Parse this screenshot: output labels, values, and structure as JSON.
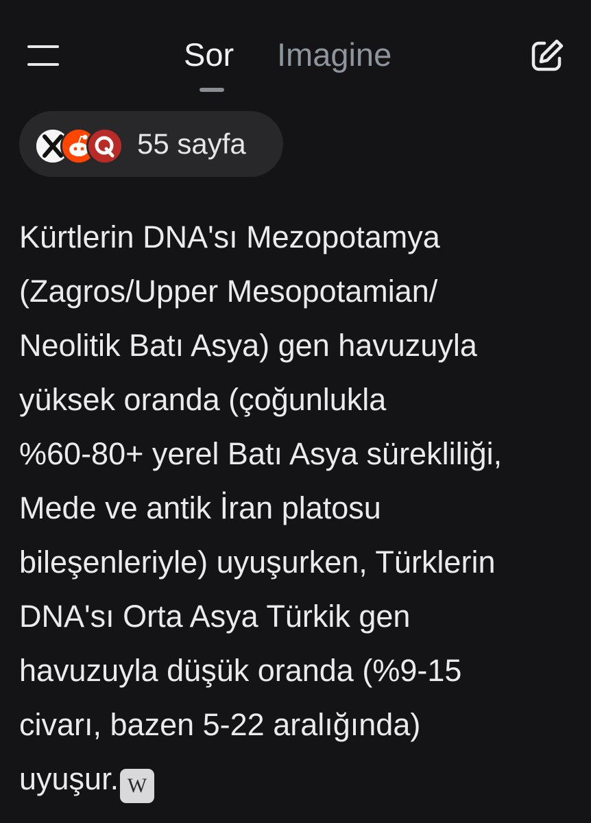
{
  "header": {
    "tabs": [
      {
        "label": "Sor",
        "active": true
      },
      {
        "label": "Imagine",
        "active": false
      }
    ],
    "menu_icon": "hamburger-menu-icon",
    "new_chat_icon": "edit-square-icon"
  },
  "sources": {
    "label": "55 sayfa",
    "favicons": [
      "x-icon",
      "reddit-icon",
      "quora-icon"
    ]
  },
  "answer": {
    "lines": [
      "Kürtlerin DNA'sı Mezopotamya",
      "(Zagros/Upper Mesopotamian/",
      "Neolitik Batı Asya) gen havuzuyla",
      "yüksek oranda (çoğunlukla",
      "%60-80+ yerel Batı Asya sürekliliği,",
      "Mede ve antik İran platosu",
      "bileşenleriyle) uyuşurken, Türklerin",
      "DNA'sı Orta Asya Türkik gen",
      "havuzuyla düşük oranda (%9-15",
      "civarı, bazen 5-22 aralığında)",
      "uyuşur."
    ],
    "citation": {
      "label": "W",
      "icon": "wikipedia-icon"
    }
  },
  "colors": {
    "background": "#141416",
    "text": "#ebebed",
    "inactive_tab": "#8f959d",
    "pill": "#28282b"
  }
}
